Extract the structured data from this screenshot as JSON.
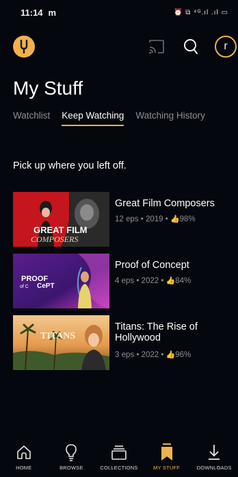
{
  "status_bar": {
    "time": "11:14",
    "notification": "m",
    "system_icons": "⏰ ⧉ ⁴ᴳ.ıl .ıl ▭"
  },
  "header": {
    "avatar_initial": "r"
  },
  "page": {
    "title": "My Stuff",
    "tabs": [
      {
        "label": "Watchlist",
        "active": false
      },
      {
        "label": "Keep Watching",
        "active": true
      },
      {
        "label": "Watching History",
        "active": false
      }
    ],
    "subtitle": "Pick up where you left off."
  },
  "items": [
    {
      "title": "Great Film Composers",
      "meta": "12 eps • 2019 • ",
      "rating": "98%",
      "thumb_text": [
        "GREAT FILM",
        "COMPOSERS"
      ]
    },
    {
      "title": "Proof of Concept",
      "meta": "4 eps • 2022 • ",
      "rating": "84%",
      "thumb_text": [
        "PROOF",
        "of C",
        "CePT"
      ]
    },
    {
      "title": "Titans: The Rise of Hollywood",
      "meta": "3 eps • 2022 • ",
      "rating": "96%",
      "thumb_text": [
        "TITANS"
      ]
    }
  ],
  "nav": [
    {
      "label": "HOME",
      "icon": "home-icon"
    },
    {
      "label": "BROWSE",
      "icon": "lightbulb-icon"
    },
    {
      "label": "COLLECTIONS",
      "icon": "collections-icon"
    },
    {
      "label": "MY STUFF",
      "icon": "bookmark-icon",
      "active": true
    },
    {
      "label": "DOWNLOADS",
      "icon": "download-icon"
    }
  ],
  "colors": {
    "background": "#04070d",
    "accent": "#f0b24b",
    "muted_text": "#8b8f96"
  }
}
